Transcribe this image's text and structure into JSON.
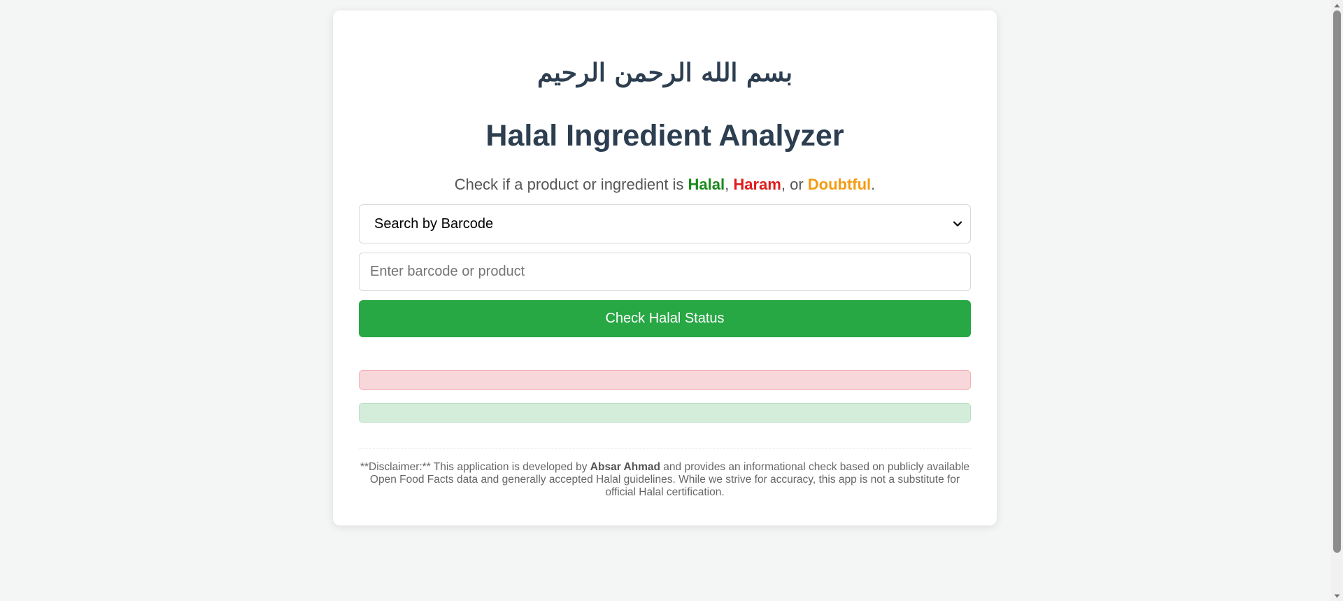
{
  "card": {
    "bismillah": "بسم الله الرحمن الرحيم",
    "title": "Halal Ingredient Analyzer",
    "subtitle": {
      "prefix": "Check if a product or ingredient is ",
      "halal": "Halal",
      "sep1": ", ",
      "haram": "Haram",
      "sep2": ", or ",
      "doubtful": "Doubtful",
      "suffix": "."
    },
    "search_mode": {
      "selected": "Search by Barcode",
      "icon": "chevron-down-icon"
    },
    "search_input": {
      "value": "",
      "placeholder": "Enter barcode or product"
    },
    "check_button": "Check Halal Status",
    "disclaimer": {
      "part1": "**Disclaimer:** This application is developed by ",
      "author": "Absar Ahmad",
      "part2": " and provides an informational check based on publicly available Open Food Facts data and generally accepted Halal guidelines. While we strive for accuracy, this app is not a substitute for official Halal certification."
    }
  },
  "colors": {
    "halal": "#1a8a1a",
    "haram": "#e01b1b",
    "doubtful": "#f39c12",
    "button": "#28a745",
    "error_bar": "#f8d7da",
    "success_bar": "#d4edda"
  }
}
